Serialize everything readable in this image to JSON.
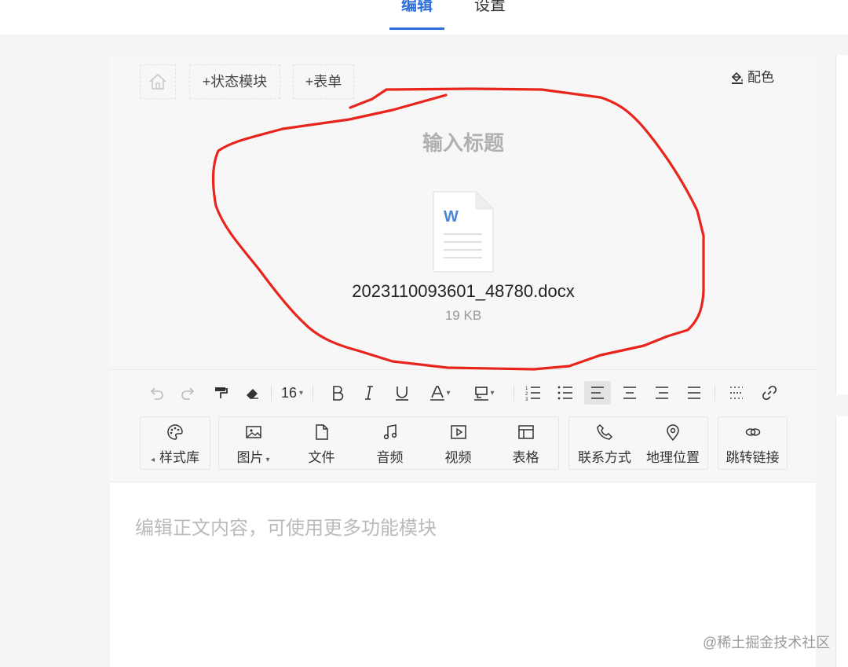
{
  "tabs": [
    {
      "label": "编辑",
      "active": true
    },
    {
      "label": "设置",
      "active": false
    }
  ],
  "header": {
    "home_icon": "home-icon",
    "add_status_module": "+状态模块",
    "add_form": "+表单",
    "palette": "配色"
  },
  "document": {
    "title_placeholder": "输入标题",
    "file_icon": "word-document-icon",
    "file_letter": "W",
    "file_name": "2023110093601_48780.docx",
    "file_size": "19 KB"
  },
  "toolbar": {
    "font_size": "16",
    "buttons": [
      "undo",
      "redo",
      "format-painter",
      "eraser",
      "font-size",
      "bold",
      "italic",
      "underline",
      "font-color",
      "highlight",
      "ordered-list",
      "unordered-list",
      "align-left",
      "align-center",
      "align-right",
      "justify",
      "divider",
      "link"
    ],
    "active_button": "align-left"
  },
  "modules": {
    "style_library": "样式库",
    "image": "图片",
    "file": "文件",
    "audio": "音频",
    "video": "视频",
    "table": "表格",
    "contact": "联系方式",
    "location": "地理位置",
    "jump_link": "跳转链接"
  },
  "body": {
    "placeholder": "编辑正文内容，可使用更多功能模块"
  },
  "colors": {
    "accent": "#2f6fdb",
    "annotation": "#e8241c"
  },
  "watermark": "@稀土掘金技术社区"
}
